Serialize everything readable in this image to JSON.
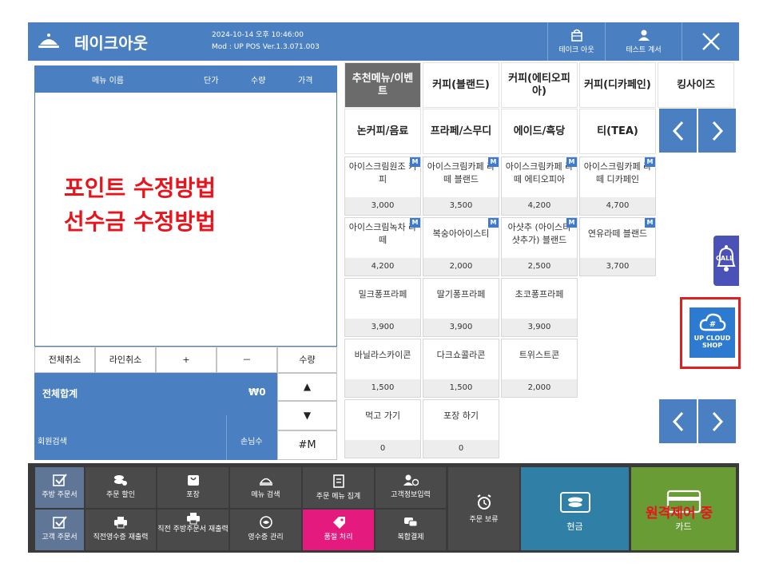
{
  "header": {
    "title": "테이크아웃",
    "datetime": "2024-10-14 오후 10:46:00",
    "version": "Mod : UP POS Ver.1.3.071.003",
    "takeout_label": "테이크 아웃",
    "test_label": "테스트 계서"
  },
  "order_table": {
    "columns": [
      "메뉴 이름",
      "단가",
      "수량",
      "가격"
    ]
  },
  "overlay_text": [
    "포인트 수정방법",
    "선수금 수정방법"
  ],
  "controls": {
    "cancel_all": "전체취소",
    "cancel_line": "라인취소",
    "plus": "+",
    "minus": "－",
    "qty": "수량",
    "up": "▲",
    "down": "▼",
    "hash_m": "#M"
  },
  "total": {
    "label": "전체합계",
    "amount": "₩0"
  },
  "member": {
    "search_label": "회원검색",
    "guests_label": "손님수"
  },
  "categories": [
    "추천메뉴/이벤트",
    "커피(블랜드)",
    "커피(에티오피아)",
    "커피(디카페인)",
    "킹사이즈",
    "논커피/음료",
    "프라페/스무디",
    "에이드/흑당",
    "티(TEA)"
  ],
  "menu_items": [
    {
      "name": "아이스크림원조 커피",
      "price": "3,000",
      "badge": "M"
    },
    {
      "name": "아이스크림카페 라떼 블랜드",
      "price": "3,500",
      "badge": "M"
    },
    {
      "name": "아이스크림카페 라떼 에티오피아",
      "price": "4,200",
      "badge": "M"
    },
    {
      "name": "아이스크림카페 라떼 디카페인",
      "price": "4,700",
      "badge": "M"
    },
    {
      "name": "아이스크림녹차 라떼",
      "price": "4,200",
      "badge": "M"
    },
    {
      "name": "복숭아아이스티",
      "price": "2,000",
      "badge": "M"
    },
    {
      "name": "아샷추 (아이스티 샷추가) 블랜드",
      "price": "2,500",
      "badge": "M"
    },
    {
      "name": "연유라떼 블랜드",
      "price": "3,700",
      "badge": "M"
    },
    {
      "name": "밀크퐁프라페",
      "price": "3,900",
      "badge": ""
    },
    {
      "name": "딸기퐁프라페",
      "price": "3,900",
      "badge": ""
    },
    {
      "name": "초코퐁프라페",
      "price": "3,900",
      "badge": ""
    },
    {
      "name": "바닐라스카이콘",
      "price": "1,500",
      "badge": ""
    },
    {
      "name": "다크쇼콜라콘",
      "price": "1,500",
      "badge": ""
    },
    {
      "name": "트위스트콘",
      "price": "2,000",
      "badge": ""
    },
    {
      "name": "먹고 가기",
      "price": "0",
      "badge": ""
    },
    {
      "name": "포장 하기",
      "price": "0",
      "badge": ""
    }
  ],
  "toolbar": {
    "kitchen_order": "주방 주문서",
    "order_discount": "주문 할인",
    "packaging": "포장",
    "menu_search": "메뉴 검색",
    "order_menu_total": "주문 메뉴 집계",
    "customer_info": "고객정보입력",
    "customer_order": "고객 주문서",
    "reprint_receipt": "직전영수증 재출력",
    "reprint_kitchen": "직전 주방주문서 재출력",
    "receipt_manage": "영수증 관리",
    "sold_out": "품절 처리",
    "split_pay": "복합결제",
    "hold_order": "주문 보류",
    "cash": "현금",
    "card": "카드"
  },
  "remote_control_text": "원격제어 중",
  "call_label": "CALL",
  "cloud_shop": {
    "line1": "UP CLOUD",
    "line2": "SHOP"
  },
  "colors": {
    "header_blue": "#4a7fc1",
    "active_tab": "#6b6b6b",
    "toolbar_bg": "#3a3a3a",
    "sold_out_pink": "#e41a7f",
    "cash_teal": "#2f7fa6",
    "card_green": "#6a9c35",
    "alert_red": "#e8141c"
  }
}
